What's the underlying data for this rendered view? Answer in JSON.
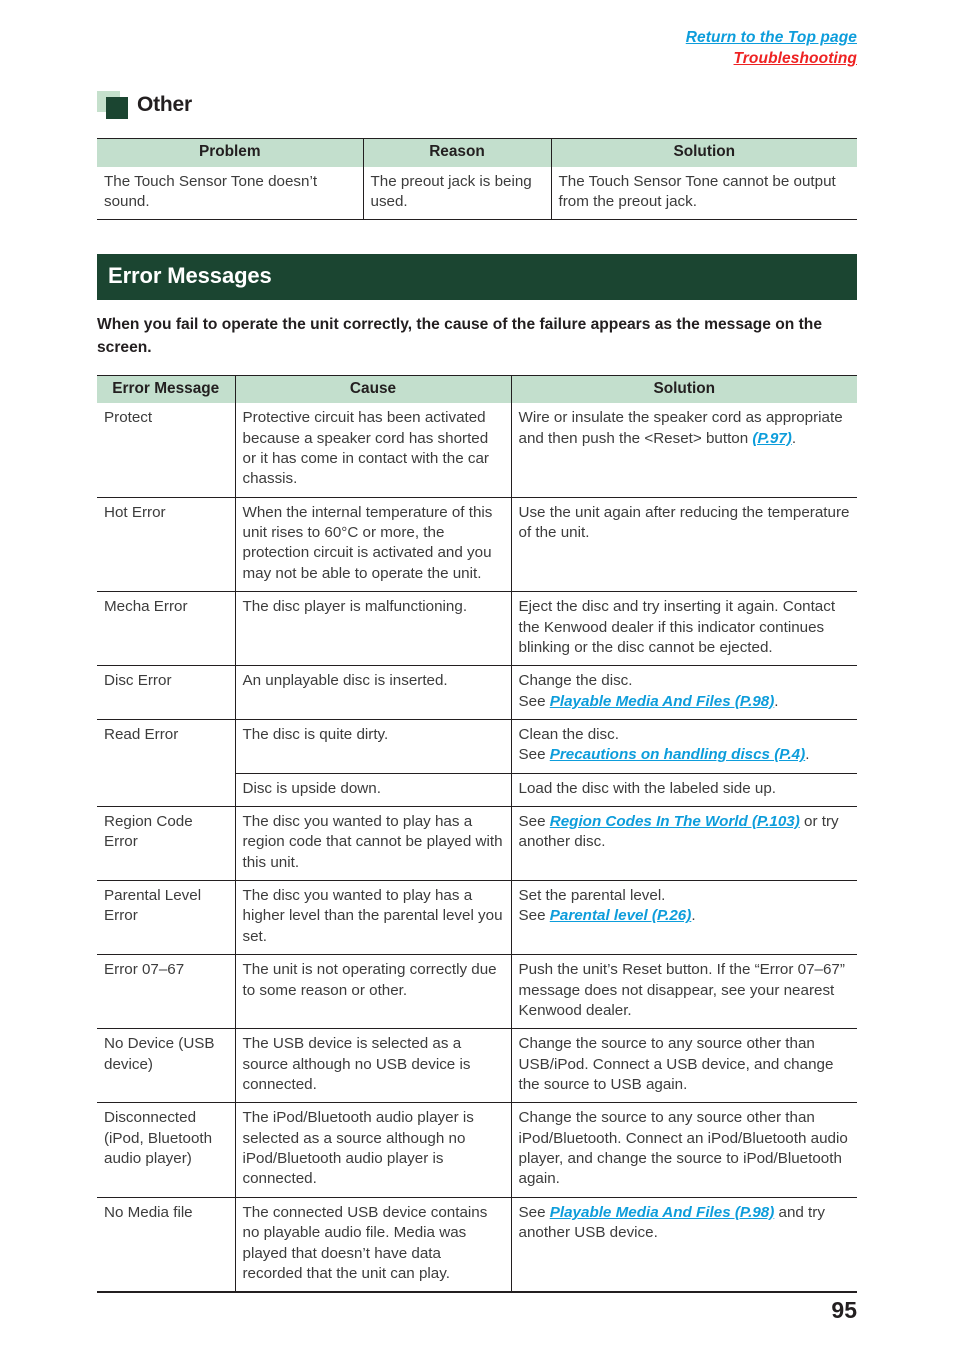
{
  "top_links": [
    {
      "label": "Return to the Top page",
      "color": "#0d9ddb"
    },
    {
      "label": "Troubleshooting",
      "color": "#ee2222"
    }
  ],
  "section": {
    "title": "Other",
    "mark_light_color": "#c5e0cc",
    "mark_dark_color": "#1b4531"
  },
  "other_table": {
    "headers": [
      "Problem",
      "Reason",
      "Solution"
    ],
    "rows": [
      {
        "problem": "The Touch Sensor Tone doesn’t sound.",
        "reason": "The preout jack is being used.",
        "solution": "The Touch Sensor Tone cannot be output from the preout jack."
      }
    ]
  },
  "banner": {
    "title": "Error Messages",
    "bg_color": "#1b4531"
  },
  "intro": "When you fail to operate the unit correctly, the cause of the failure appears as the message on the screen.",
  "error_table": {
    "headers": [
      "Error Message",
      "Cause",
      "Solution"
    ],
    "rows": [
      {
        "message": "Protect",
        "cause": "Protective circuit has been activated because a speaker cord has shorted or it has come in contact with the car chassis.",
        "solution_pre": "Wire or insulate the speaker cord as appropriate and then push the <Reset> button ",
        "solution_link": "(P.97)",
        "solution_post": "."
      },
      {
        "message": "Hot Error",
        "cause": "When the internal temperature of this unit rises to 60°C or more, the protection circuit is activated and you may not be able to operate the unit.",
        "solution_pre": "Use the unit again after reducing the temperature of the unit.",
        "solution_link": "",
        "solution_post": ""
      },
      {
        "message": "Mecha Error",
        "cause": "The disc player is malfunctioning.",
        "solution_pre": "Eject the disc and try inserting it again. Contact the Kenwood dealer if this indicator continues blinking or the disc cannot be ejected.",
        "solution_link": "",
        "solution_post": ""
      },
      {
        "message": "Disc Error",
        "cause": "An unplayable disc is inserted.",
        "solution_pre": "Change the disc.\nSee ",
        "solution_link": "Playable Media And Files (P.98)",
        "solution_post": "."
      },
      {
        "message": "Read Error",
        "cause": "The disc is quite dirty.",
        "solution_pre": "Clean the disc.\nSee ",
        "solution_link": "Precautions on handling discs (P.4)",
        "solution_post": "."
      },
      {
        "message": "",
        "cause": "Disc is upside down.",
        "solution_pre": "Load the disc with the labeled side up.",
        "solution_link": "",
        "solution_post": "",
        "is_sub": true
      },
      {
        "message": "Region Code Error",
        "cause": "The disc you wanted to play has a region code that cannot be played with this unit.",
        "solution_pre": "See ",
        "solution_link": "Region Codes In The World (P.103)",
        "solution_post": " or try another disc."
      },
      {
        "message": "Parental Level Error",
        "cause": "The disc you wanted to play has a higher level than the parental level you set.",
        "solution_pre": "Set the parental level.\nSee ",
        "solution_link": "Parental level (P.26)",
        "solution_post": "."
      },
      {
        "message": "Error 07–67",
        "cause": "The unit is not operating correctly due to some reason or other.",
        "solution_pre": "Push the unit’s Reset button. If the “Error 07–67” message does not disappear, see your nearest Kenwood dealer.",
        "solution_link": "",
        "solution_post": ""
      },
      {
        "message": "No Device (USB device)",
        "cause": "The USB device is selected as a source although no USB device is connected.",
        "solution_pre": "Change the source to any source other than USB/iPod. Connect a USB device, and change the source to USB again.",
        "solution_link": "",
        "solution_post": ""
      },
      {
        "message": "Disconnected (iPod, Bluetooth audio player)",
        "cause": "The iPod/Bluetooth audio player is selected as a source although no iPod/Bluetooth audio player is connected.",
        "solution_pre": "Change the source to any source other than iPod/Bluetooth. Connect an iPod/Bluetooth audio player, and change the source to iPod/Bluetooth again.",
        "solution_link": "",
        "solution_post": ""
      },
      {
        "message": "No Media file",
        "cause": "The connected USB device contains no playable audio file. Media was played that doesn’t have data recorded that the unit can play.",
        "solution_pre": "See ",
        "solution_link": "Playable Media And Files (P.98)",
        "solution_post": " and try another USB device."
      }
    ]
  },
  "page_number": "95",
  "link_color": "#0d9ddb"
}
